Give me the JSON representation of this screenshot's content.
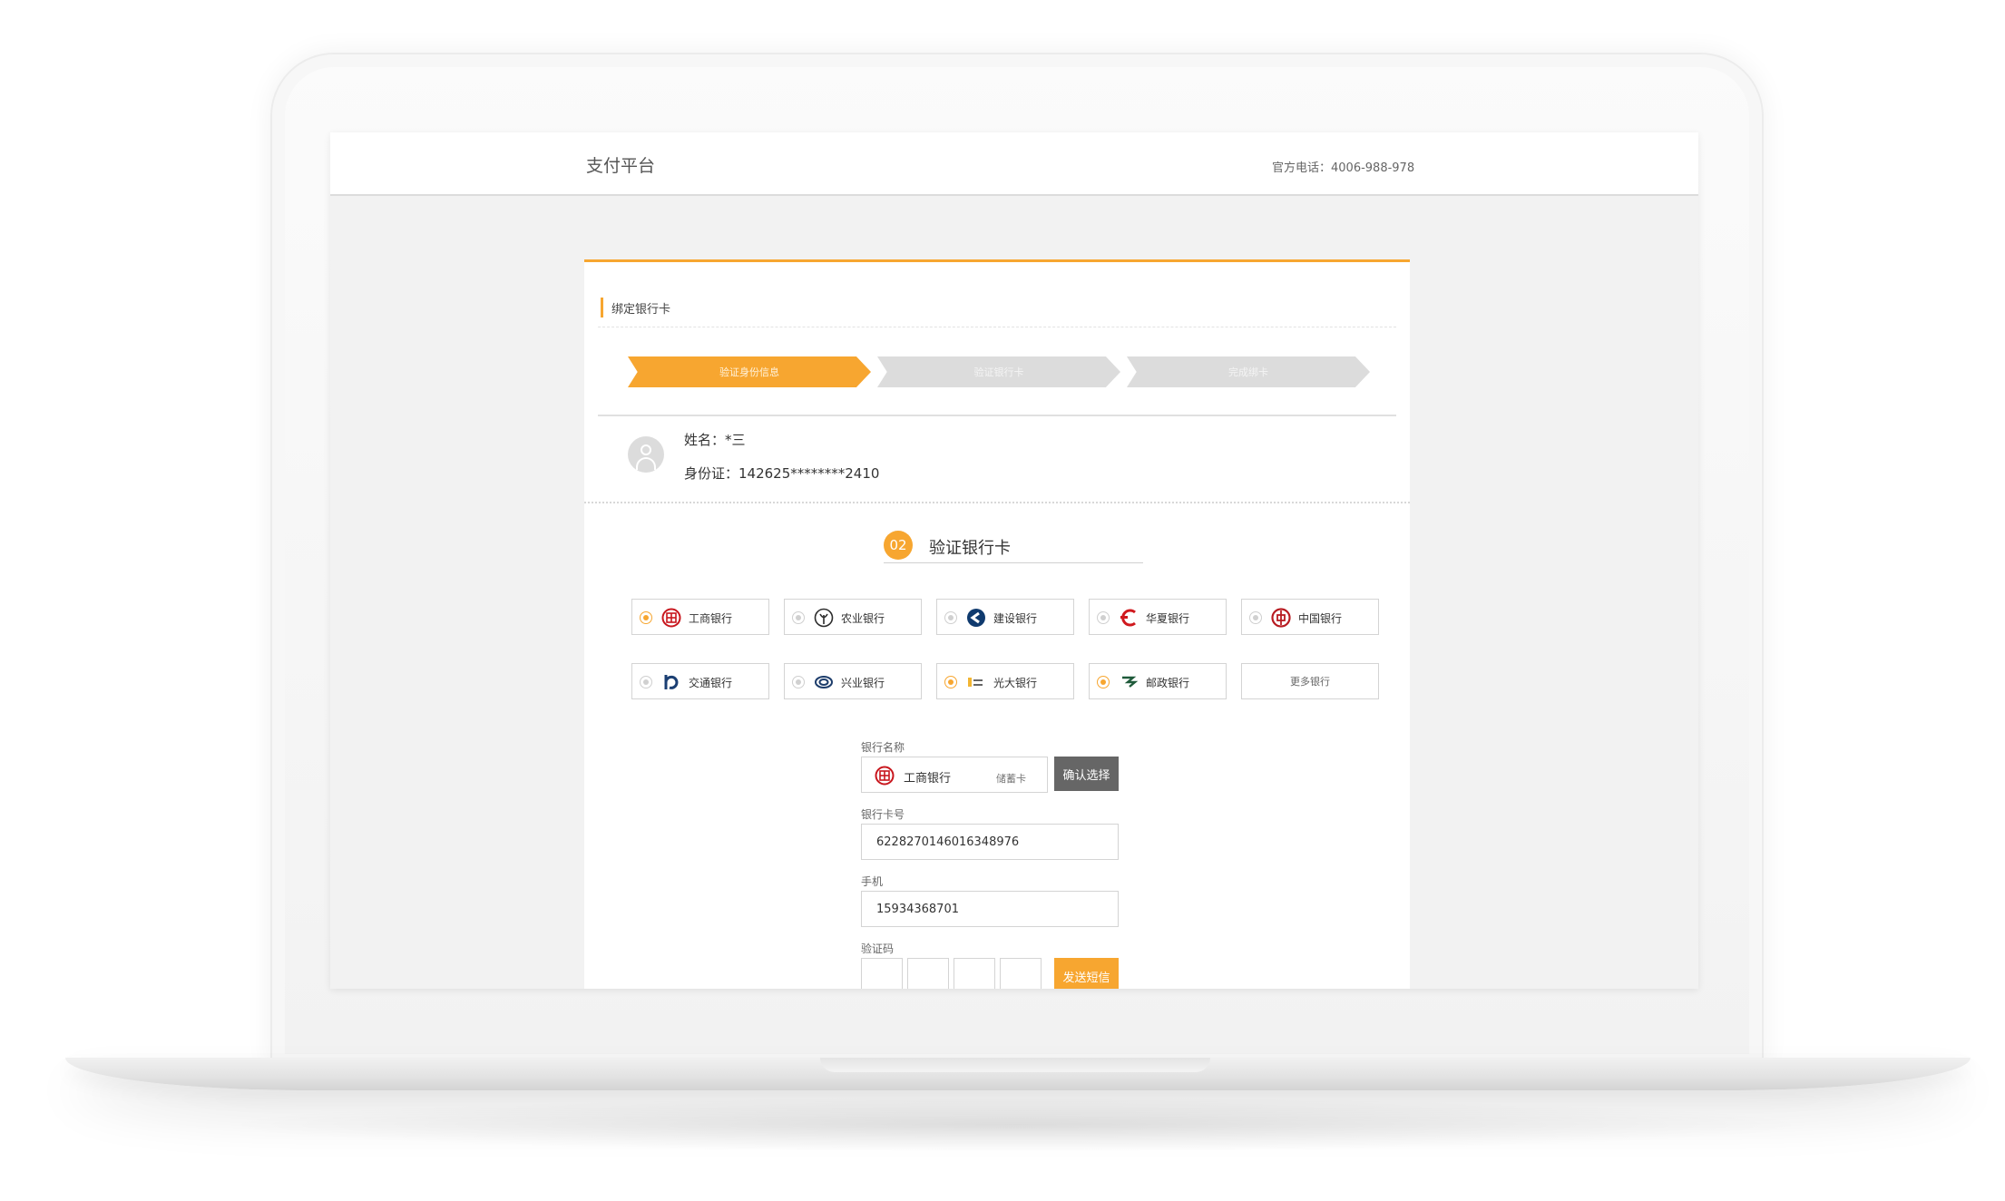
{
  "header": {
    "brand": "支付平台",
    "hotline": "官方电话：4006-988-978"
  },
  "card": {
    "title": "绑定银行卡",
    "steps": [
      {
        "label": "验证身份信息",
        "active": true
      },
      {
        "label": "验证银行卡",
        "active": false
      },
      {
        "label": "完成绑卡",
        "active": false
      }
    ],
    "user": {
      "name": "姓名：*三",
      "id": "身份证：142625********2410"
    },
    "section": {
      "number": "02",
      "title": "验证银行卡"
    },
    "banks": [
      {
        "label": "工商银行",
        "icon": "icbc-icon",
        "selected": true
      },
      {
        "label": "农业银行",
        "icon": "abc-icon",
        "selected": false
      },
      {
        "label": "建设银行",
        "icon": "ccb-icon",
        "selected": false
      },
      {
        "label": "华夏银行",
        "icon": "hxb-icon",
        "selected": false
      },
      {
        "label": "中国银行",
        "icon": "boc-icon",
        "selected": false
      },
      {
        "label": "交通银行",
        "icon": "bocom-icon",
        "selected": false
      },
      {
        "label": "兴业银行",
        "icon": "cib-icon",
        "selected": false
      },
      {
        "label": "光大银行",
        "icon": "ceb-icon",
        "selected": true
      },
      {
        "label": "邮政银行",
        "icon": "psbc-icon",
        "selected": true
      }
    ],
    "more_banks": "更多银行"
  },
  "form": {
    "bank_name_label": "银行名称",
    "bank_name_value": "工商银行",
    "card_type": "储蓄卡",
    "confirm_button": "确认选择",
    "card_number_label": "银行卡号",
    "card_number_value": "6228270146016348976",
    "phone_label": "手机",
    "phone_value": "15934368701",
    "code_label": "验证码",
    "sms_button": "发送短信"
  },
  "colors": {
    "accent": "#f7a630",
    "icbc": "#c8161d",
    "ccb": "#0f3a6e",
    "boc": "#b81c22",
    "bocom": "#1b3f73"
  }
}
